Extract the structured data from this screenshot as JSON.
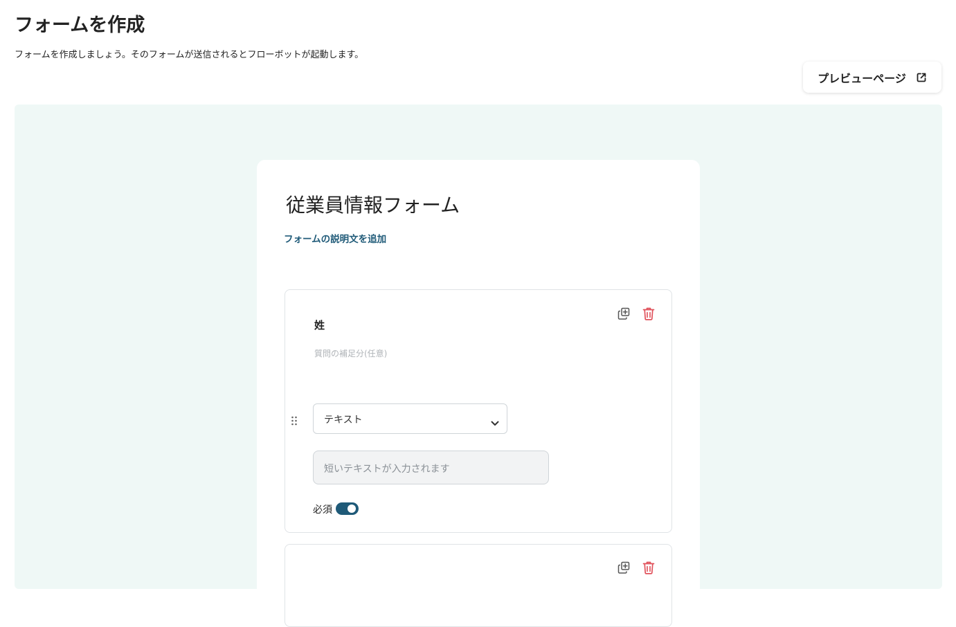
{
  "header": {
    "title": "フォームを作成",
    "subtitle": "フォームを作成しましょう。そのフォームが送信されるとフローボットが起動します。",
    "preview_button_label": "プレビューページ"
  },
  "form": {
    "title": "従業員情報フォーム",
    "add_description_label": "フォームの説明文を追加",
    "questions": [
      {
        "label": "姓",
        "hint_placeholder": "質問の補足分(任意)",
        "type": "テキスト",
        "answer_placeholder": "短いテキストが入力されます",
        "required_label": "必須",
        "required": true
      },
      {
        "label": "",
        "required": false
      }
    ]
  },
  "icons": {
    "preview": "external-link-icon",
    "copy": "copy-icon",
    "delete": "trash-icon",
    "drag": "drag-handle-icon",
    "select": "chevron-down-icon"
  },
  "colors": {
    "accent": "#1f5a78",
    "canvas_background": "#eff8f6",
    "delete": "#e0505a"
  }
}
